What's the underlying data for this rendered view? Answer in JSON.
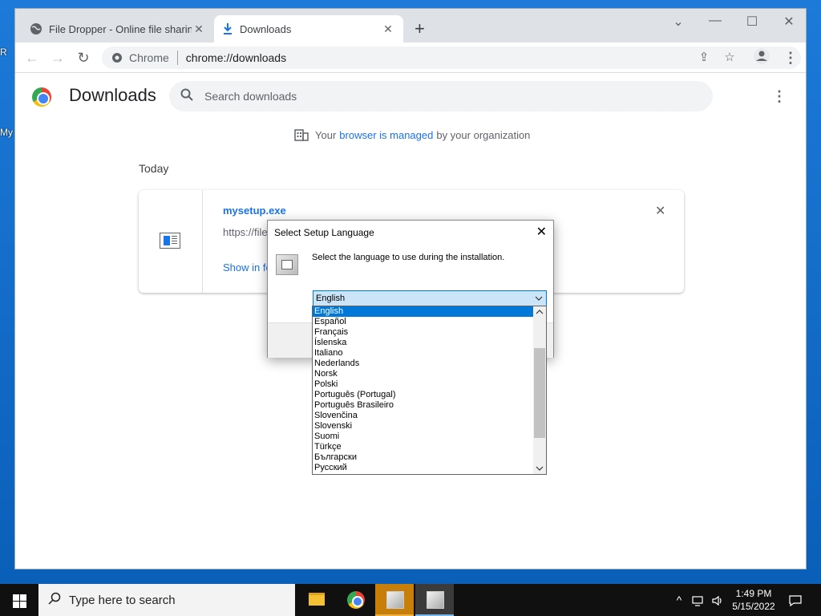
{
  "desktop": {
    "labels": [
      "R",
      "My"
    ]
  },
  "browser": {
    "tabs": [
      {
        "title": "File Dropper - Online file sharing",
        "active": false
      },
      {
        "title": "Downloads",
        "active": true
      }
    ],
    "new_tab": "+",
    "window_controls": {
      "minimize": "—",
      "maximize": "☐",
      "close": "✕",
      "tab_search": "⌄"
    },
    "omnibox": {
      "scheme_label": "Chrome",
      "url": "chrome://downloads"
    }
  },
  "downloads": {
    "title": "Downloads",
    "search_placeholder": "Search downloads",
    "managed": {
      "prefix": "Your",
      "link": "browser is managed",
      "suffix": "by your organization"
    },
    "section": "Today",
    "items": [
      {
        "filename": "mysetup.exe",
        "url": "https://file",
        "action": "Show in fo"
      }
    ]
  },
  "dialog": {
    "title": "Select Setup Language",
    "message": "Select the language to use during the installation.",
    "selected": "English",
    "languages": [
      "English",
      "Español",
      "Français",
      "Íslenska",
      "Italiano",
      "Nederlands",
      "Norsk",
      "Polski",
      "Português (Portugal)",
      "Português Brasileiro",
      "Slovenčina",
      "Slovenski",
      "Suomi",
      "Türkçe",
      "Български",
      "Русский"
    ],
    "highlighted_index": 0
  },
  "taskbar": {
    "search_placeholder": "Type here to search",
    "time": "1:49 PM",
    "date": "5/15/2022"
  },
  "colors": {
    "accent": "#1a73e8",
    "selection": "#0078d7",
    "desktop": "#0a5fb8"
  }
}
